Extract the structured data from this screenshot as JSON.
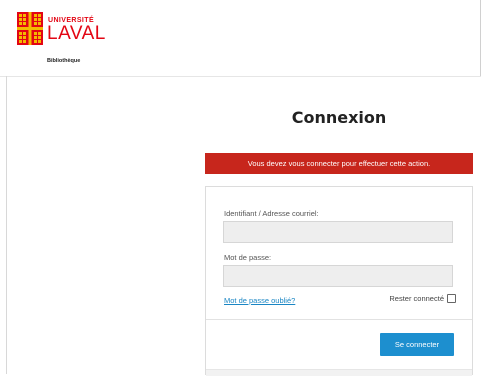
{
  "header": {
    "logo_univ": "UNIVERSITÉ",
    "logo_laval": "LAVAL",
    "logo_biblio": "Bibliothèque",
    "brand_red": "#e30513",
    "brand_gold": "#f5b800"
  },
  "login": {
    "title": "Connexion",
    "alert": "Vous devez vous connecter pour effectuer cette action.",
    "alert_color": "#c7261c",
    "username_label": "Identifiant / Adresse courriel:",
    "username_value": "",
    "password_label": "Mot de passe:",
    "password_value": "",
    "forgot_link": "Mot de passe oublié?",
    "remember_label": "Rester connecté",
    "remember_checked": false,
    "submit_label": "Se connecter",
    "submit_color": "#1d8fcf"
  }
}
